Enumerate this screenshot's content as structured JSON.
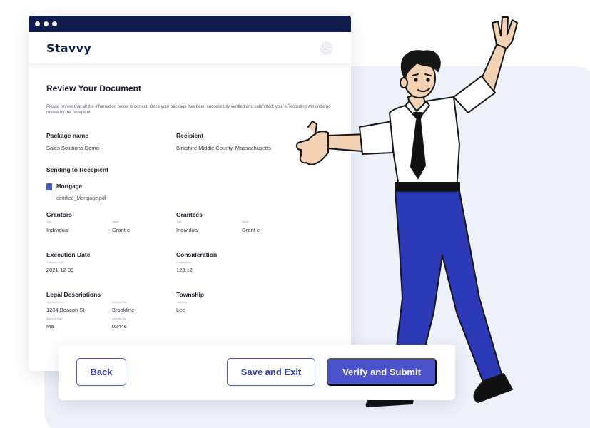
{
  "app": {
    "logo": "Stavvy"
  },
  "review": {
    "title": "Review Your Document",
    "description": "Please review that all the information below is correct. Once your package has been successfully verified and submitted, your eRecording will undergo review by the recepient.",
    "package_name_label": "Package name",
    "package_name": "Sales Solutions Demo",
    "recipient_label": "Recipient",
    "recipient": "Birkshire Middle County, Massachusetts",
    "sending_label": "Sending to Recepient",
    "document_name": "Mortgage",
    "document_file": "certified_Mortgage.pdf",
    "grantors": {
      "label": "Grantors",
      "type_label": "Type",
      "name_label": "Name",
      "type": "Individual",
      "name": "Grant e"
    },
    "grantees": {
      "label": "Grantees",
      "type_label": "Type",
      "name_label": "Name",
      "type": "Individual",
      "name": "Grant e"
    },
    "execution": {
      "label": "Execution Date",
      "sub_label": "Execution Date",
      "value": "2021-12-09"
    },
    "consideration": {
      "label": "Consideration",
      "sub_label": "Consideration",
      "value": "123.12"
    },
    "legal": {
      "label": "Legal Descriptions",
      "street_label": "Address Street",
      "street": "1234 Beacon St",
      "city_label": "Address City",
      "city": "Brookline",
      "state_label": "Address State",
      "state": "Ma",
      "zip_label": "Address Zip",
      "zip": "02446"
    },
    "township": {
      "label": "Township",
      "sub_label": "Township",
      "value": "Lee"
    }
  },
  "actions": {
    "back": "Back",
    "save_exit": "Save and Exit",
    "verify_submit": "Verify and Submit"
  },
  "colors": {
    "navy": "#0f1c4d",
    "accent": "#4a52cc",
    "panel": "#eef1fa"
  },
  "icons": {
    "window_dots": "traffic-dots",
    "back": "left-arrow-icon",
    "document": "document-icon"
  }
}
